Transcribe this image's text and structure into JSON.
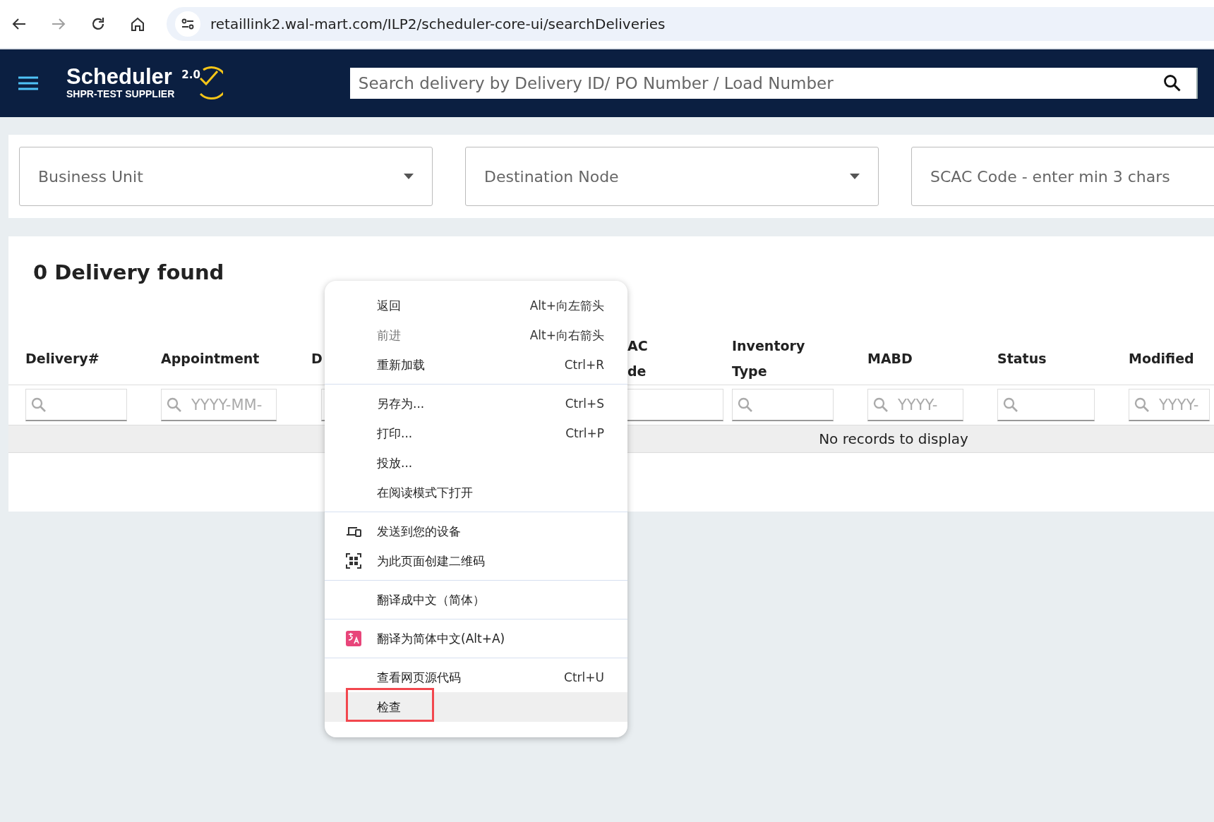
{
  "browser": {
    "url": "retaillink2.wal-mart.com/ILP2/scheduler-core-ui/searchDeliveries",
    "back_disabled": false,
    "forward_disabled": true
  },
  "header": {
    "title": "Scheduler",
    "version": "2.0",
    "subtitle": "SHPR-TEST SUPPLIER",
    "search": {
      "placeholder": "Search delivery by Delivery ID/ PO Number / Load Number"
    }
  },
  "filters": [
    {
      "kind": "select",
      "placeholder": "Business Unit"
    },
    {
      "kind": "select",
      "placeholder": "Destination Node"
    },
    {
      "kind": "text",
      "placeholder": "SCAC Code - enter min 3 chars"
    }
  ],
  "results": {
    "title": "0 Delivery found",
    "empty_message": "No records to display"
  },
  "table": {
    "columns": [
      {
        "lines": [
          "Delivery#"
        ]
      },
      {
        "lines": [
          "Appointment"
        ],
        "filter_placeholder": "YYYY-MM-"
      },
      {
        "lines": [
          "D"
        ]
      },
      {
        "lines": [
          "AC",
          "de"
        ]
      },
      {
        "lines": [
          "Inventory",
          "Type"
        ]
      },
      {
        "lines": [
          "MABD"
        ],
        "filter_placeholder": "YYYY-"
      },
      {
        "lines": [
          "Status"
        ]
      },
      {
        "lines": [
          "Modified"
        ],
        "filter_placeholder": "YYYY-"
      }
    ]
  },
  "context_menu": {
    "groups": [
      {
        "items": [
          {
            "label": "返回",
            "shortcut": "Alt+向左箭头",
            "disabled": false,
            "highlighted": false,
            "marked": false
          },
          {
            "label": "前进",
            "shortcut": "Alt+向右箭头",
            "disabled": true,
            "highlighted": false,
            "marked": false
          },
          {
            "label": "重新加载",
            "shortcut": "Ctrl+R",
            "disabled": false,
            "highlighted": false,
            "marked": false
          }
        ]
      },
      {
        "items": [
          {
            "label": "另存为...",
            "shortcut": "Ctrl+S",
            "disabled": false,
            "highlighted": false,
            "marked": false
          },
          {
            "label": "打印...",
            "shortcut": "Ctrl+P",
            "disabled": false,
            "highlighted": false,
            "marked": false
          },
          {
            "label": "投放...",
            "disabled": false,
            "highlighted": false,
            "marked": false
          },
          {
            "label": "在阅读模式下打开",
            "disabled": false,
            "highlighted": false,
            "marked": false
          }
        ]
      },
      {
        "items": [
          {
            "label": "发送到您的设备",
            "kind": "devices",
            "disabled": false,
            "highlighted": false,
            "marked": false
          },
          {
            "label": "为此页面创建二维码",
            "kind": "qr",
            "disabled": false,
            "highlighted": false,
            "marked": false
          }
        ]
      },
      {
        "items": [
          {
            "label": "翻译成中文（简体）",
            "disabled": false,
            "highlighted": false,
            "marked": false
          }
        ]
      },
      {
        "items": [
          {
            "label": "翻译为简体中文(Alt+A)",
            "kind": "translate",
            "disabled": false,
            "highlighted": false,
            "marked": false
          }
        ]
      },
      {
        "items": [
          {
            "label": "查看网页源代码",
            "shortcut": "Ctrl+U",
            "disabled": false,
            "highlighted": false,
            "marked": false
          },
          {
            "label": "检查",
            "disabled": false,
            "highlighted": true,
            "marked": true
          }
        ]
      }
    ]
  }
}
